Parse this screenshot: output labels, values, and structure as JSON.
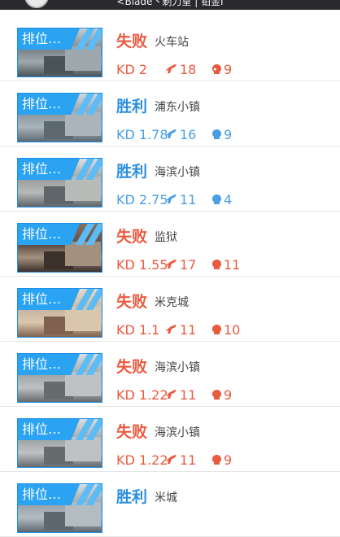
{
  "header": {
    "player": "<Blade丶剃刀皇 | 铂金I"
  },
  "matches": [
    {
      "badge": "排位…",
      "result": "失败",
      "outcome": "lose",
      "map": "火车站",
      "kd": "KD 2",
      "kills": "18",
      "deaths": "9"
    },
    {
      "badge": "排位…",
      "result": "胜利",
      "outcome": "win",
      "map": "浦东小镇",
      "kd": "KD 1.78",
      "kills": "16",
      "deaths": "9"
    },
    {
      "badge": "排位…",
      "result": "胜利",
      "outcome": "win",
      "map": "海滨小镇",
      "kd": "KD 2.75",
      "kills": "11",
      "deaths": "4"
    },
    {
      "badge": "排位…",
      "result": "失败",
      "outcome": "lose",
      "map": "监狱",
      "kd": "KD 1.55",
      "kills": "17",
      "deaths": "11"
    },
    {
      "badge": "排位…",
      "result": "失败",
      "outcome": "lose",
      "map": "米克城",
      "kd": "KD 1.1",
      "kills": "11",
      "deaths": "10"
    },
    {
      "badge": "排位…",
      "result": "失败",
      "outcome": "lose",
      "map": "海滨小镇",
      "kd": "KD 1.22",
      "kills": "11",
      "deaths": "9"
    },
    {
      "badge": "排位…",
      "result": "失败",
      "outcome": "lose",
      "map": "海滨小镇",
      "kd": "KD 1.22",
      "kills": "11",
      "deaths": "9"
    },
    {
      "badge": "排位…",
      "result": "胜利",
      "outcome": "win",
      "map": "米城",
      "kd": "",
      "kills": "",
      "deaths": ""
    }
  ],
  "colors": {
    "lose": "#ea5a3f",
    "win": "#2b8fe0",
    "badge": "#29a3f2"
  },
  "icons": {
    "kills": "gun-icon",
    "deaths": "skull-icon"
  }
}
